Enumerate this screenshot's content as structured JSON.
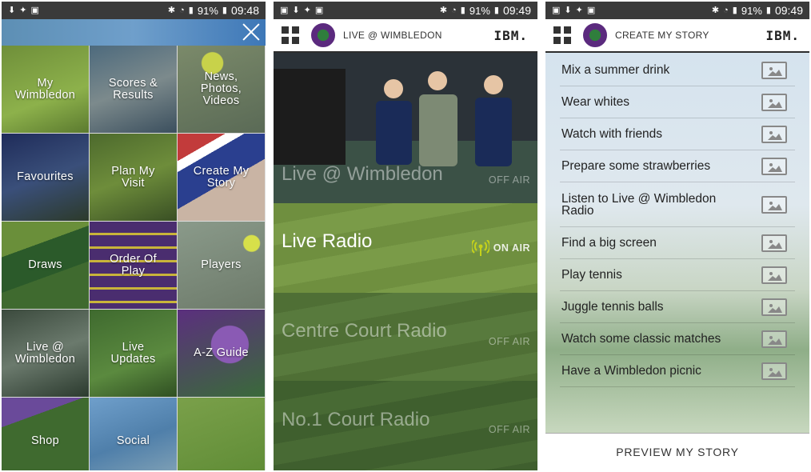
{
  "status_bars": [
    {
      "battery": "91%",
      "time": "09:48"
    },
    {
      "battery": "91%",
      "time": "09:49"
    },
    {
      "battery": "91%",
      "time": "09:49"
    }
  ],
  "menu": {
    "tiles": [
      {
        "label": "My\nWimbledon"
      },
      {
        "label": "Scores &\nResults"
      },
      {
        "label": "News,\nPhotos,\nVideos"
      },
      {
        "label": "Favourites"
      },
      {
        "label": "Plan My\nVisit"
      },
      {
        "label": "Create My\nStory"
      },
      {
        "label": "Draws"
      },
      {
        "label": "Order Of\nPlay"
      },
      {
        "label": "Players"
      },
      {
        "label": "Live @\nWimbledon"
      },
      {
        "label": "Live\nUpdates"
      },
      {
        "label": "A-Z Guide"
      },
      {
        "label": "Shop"
      },
      {
        "label": "Social"
      },
      {
        "label": ""
      }
    ]
  },
  "live": {
    "header_title": "LIVE @ WIMBLEDON",
    "brand": "IBM.",
    "panels": [
      {
        "title": "Live @ Wimbledon",
        "status": "OFF AIR"
      },
      {
        "title": "Live Radio",
        "status": "ON AIR"
      },
      {
        "title": "Centre Court Radio",
        "status": "OFF AIR"
      },
      {
        "title": "No.1 Court Radio",
        "status": "OFF AIR"
      }
    ]
  },
  "story": {
    "header_title": "CREATE MY STORY",
    "brand": "IBM.",
    "items": [
      "Mix a summer drink",
      "Wear whites",
      "Watch with friends",
      "Prepare some strawberries",
      "Listen to Live @ Wimbledon Radio",
      "Find a big screen",
      "Play tennis",
      "Juggle tennis balls",
      "Watch some classic matches",
      "Have a Wimbledon picnic"
    ],
    "preview_label": "PREVIEW MY STORY"
  },
  "colors": {
    "status_bar": "#3a3a3a",
    "on_air": "#c6d21a",
    "wimbledon_purple": "#5b2a7e",
    "wimbledon_green": "#2f7e3c"
  }
}
